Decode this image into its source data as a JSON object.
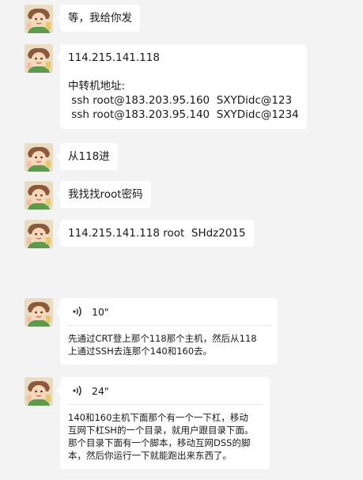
{
  "messages": [
    {
      "type": "text",
      "text": "等，我给你发"
    },
    {
      "type": "text",
      "text": "114.215.141.118\n\n中转机地址:\n ssh root@183.203.95.160  SXYDidc@123\n ssh root@183.203.95.140  SXYDidc@1234"
    },
    {
      "type": "text",
      "text": "从118进"
    },
    {
      "type": "text",
      "text": "我找找root密码"
    },
    {
      "type": "text",
      "text": "114.215.141.118 root  SHdz2015"
    },
    {
      "type": "voice",
      "duration": "10\"",
      "transcript": "先通过CRT登上那个118那个主机，然后从118\n上通过SSH去连那个140和160去。"
    },
    {
      "type": "voice",
      "duration": "24\"",
      "transcript": "140和160主机下面那个有一个一下杠，移动\n互网下杠SH的一个目录，就用户跟目录下面。\n那个目录下面有一个脚本，移动互网DSS的脚\n本，然后你运行一下就能跑出来东西了。"
    }
  ],
  "icons": {
    "avatar": "cartoon-avatar-icon",
    "voice": "voice-wave-icon"
  },
  "colors": {
    "background": "#f3f3f3",
    "bubble": "#ffffff",
    "divider": "#e6e6e6"
  }
}
